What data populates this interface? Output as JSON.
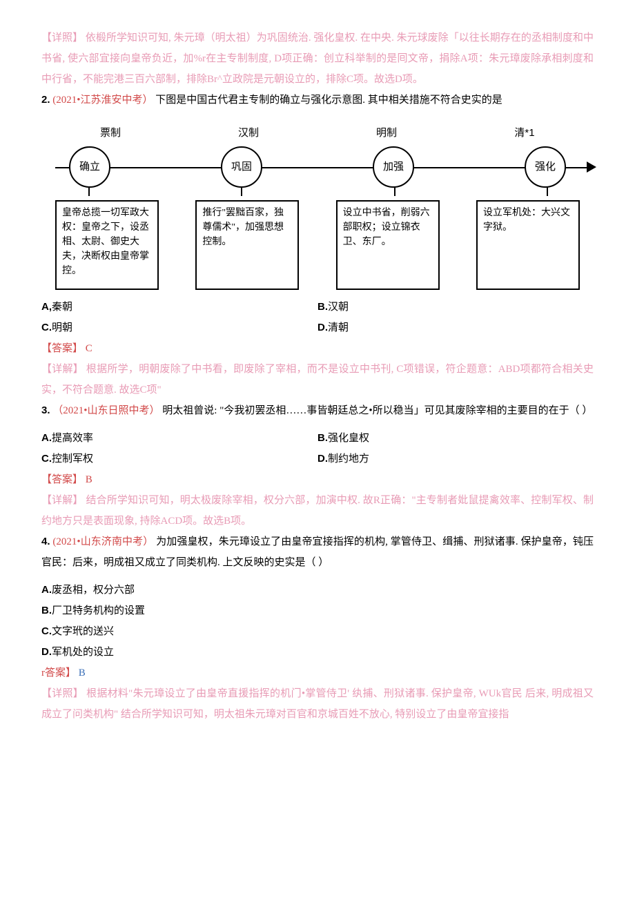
{
  "p1": {
    "tag": "【详照】",
    "text": "依椴所学知识可知, 朱元璋（明太祖）为巩固统治. 强化皇权. 在中央. 朱元球废除「以往长期存在的丞相制度和中书省, 使六部宜接向皇帝负近，加%r在主专制制度, D项正确：创立科举制的是囘文帝，捐除A项：朱元璋废除承相刺度和中行省，不能完港三百六部制，排除Br^立政院是元朝设立的，排除C项。故选D项。"
  },
  "q2": {
    "num": "2.",
    "source": "(2021•江苏淮安中考）",
    "stem": "下图是中国古代君主专制的确立与强化示意图. 其中相关措施不符合史实的是",
    "headers": [
      "票制",
      "汉制",
      "明制",
      "清*1"
    ],
    "circles": [
      "确立",
      "巩固",
      "加强",
      "强化"
    ],
    "boxes": [
      "皇帝总揽一切军政大权：皇帝之下，设丞相、太尉、御史大夫，决断权由皇帝掌控。",
      "推行\"罢黜百家，独尊儒术\"，加强思想控制。",
      "设立中书省，削弱六部职权；设立锦衣卫、东厂。",
      "设立军机处：大兴文字狱。"
    ],
    "options": {
      "A": "秦朝",
      "B": "汉朝",
      "C": "明朝",
      "D": "清朝"
    },
    "ans_tag": "【答案】",
    "ans": "C",
    "exp_tag": "【详解】",
    "exp": "根据所学，明朝废除了中书看，即废除了宰相，而不是设立中书刊, C项错误，符企题意：ABD项都符合相关史实，不符合题意. 故选C项\""
  },
  "q3": {
    "num": "3.",
    "source": "（2021•山东日照中考）",
    "stem": "明太祖曾说: \"今我初罢丞相……事皆朝廷总之•所以稳当」可见其废除宰相的主要目的在于（                           ）",
    "options": {
      "A": "提高效率",
      "B": "强化皇权",
      "C": "控制军权",
      "D": "制约地方"
    },
    "ans_tag": "【答案】",
    "ans": "B",
    "exp_tag": "【详解】",
    "exp": "结合所学知识可知，明太极废除宰相，权分六部，加演中权. 故R正确：\"主专制者妣鼠提禽效率、控制军权、制约地方只是表面现象, 持除ACD项。故选B项。"
  },
  "q4": {
    "num": "4.",
    "source": "(2021•山东济南中考）",
    "stem": "为加强皇权，朱元璋设立了由皇帝宜接指挥的机构, 掌管侍卫、缉捕、刑狱诸事. 保护皇帝，钝压官民：后来，明成祖又成立了同类机构. 上文反映的史实是（                                ）",
    "options": {
      "A": "废丞相，权分六部",
      "B": "厂卫特务机构的设置",
      "C": "文字玳的送兴",
      "D": "军机处的设立"
    },
    "ans_tag": "r答案】",
    "ans": "B",
    "exp_tag": "【详照】",
    "exp": "根据材料\"朱元璋设立了由皇帝直援指挥的机门•掌管侍卫' 纨捕、刑狱诸事. 保护皇帝, WUk官民 后来, 明成祖又成立了问类机构\" 结合所学知识可知，明太祖朱元璋对百官和京城百姓不放心, 特别设立了由皇帝宜接指"
  }
}
